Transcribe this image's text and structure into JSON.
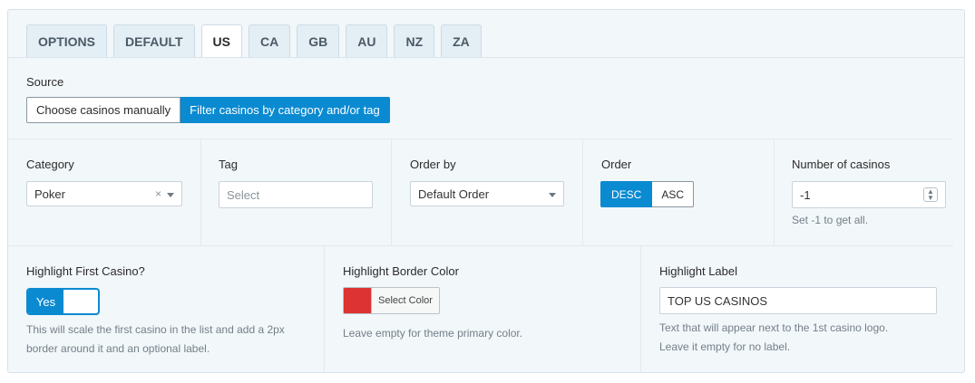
{
  "tabs": [
    "OPTIONS",
    "DEFAULT",
    "US",
    "CA",
    "GB",
    "AU",
    "NZ",
    "ZA"
  ],
  "active_tab": "US",
  "source": {
    "label": "Source",
    "options": [
      "Choose casinos manually",
      "Filter casinos by category and/or tag"
    ],
    "selected_index": 1
  },
  "category": {
    "label": "Category",
    "value": "Poker",
    "clear_glyph": "×"
  },
  "tag": {
    "label": "Tag",
    "placeholder": "Select"
  },
  "order_by": {
    "label": "Order by",
    "value": "Default Order"
  },
  "order": {
    "label": "Order",
    "options": [
      "DESC",
      "ASC"
    ],
    "selected": "DESC"
  },
  "number_of_casinos": {
    "label": "Number of casinos",
    "value": "-1",
    "help": "Set -1 to get all."
  },
  "highlight_first": {
    "label": "Highlight First Casino?",
    "toggle_label": "Yes",
    "help_line1": "This will scale the first casino in the list and add a 2px",
    "help_line2": "border around it and an optional label."
  },
  "border_color": {
    "label": "Highlight Border Color",
    "button_label": "Select Color",
    "swatch_color": "#dd3333",
    "help": "Leave empty for theme primary color."
  },
  "highlight_label": {
    "label": "Highlight Label",
    "value": "TOP US CASINOS",
    "help_line1": "Text that will appear next to the 1st casino logo.",
    "help_line2": "Leave it empty for no label."
  }
}
